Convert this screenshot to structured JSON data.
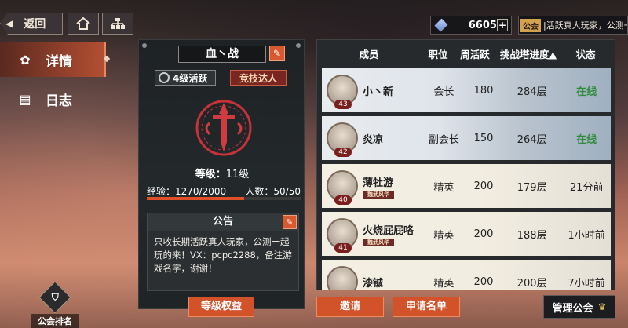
{
  "topbar": {
    "back_label": "返回",
    "currency_value": "6605",
    "ticker_tag": "公会",
    "ticker_text": "|活跃真人玩家，公测一"
  },
  "nav": {
    "detail_label": "详情",
    "log_label": "日志",
    "rank_label": "公会排名"
  },
  "guild": {
    "name": "血丶战",
    "activity_tag": "4级活跃",
    "arena_tag": "竞技达人",
    "level_label": "等级：",
    "level_value": "11级",
    "exp_label": "经验：1270/2000",
    "members_label": "人数：50/50",
    "exp_fraction": 0.635,
    "notice_title": "公告",
    "notice_text": "只收长期活跃真人玩家，公测一起玩的来！VX：pcpc2288，备注游戏名字，谢谢！",
    "benefit_button": "等级权益"
  },
  "members": {
    "headers": {
      "member": "成员",
      "role": "职位",
      "weekly": "周活跃",
      "tower": "挑战塔进度▲",
      "status": "状态"
    },
    "rows": [
      {
        "level": "43",
        "name": "小丶新",
        "sub": "",
        "role": "会长",
        "weekly": "180",
        "tower": "284层",
        "status": "在线",
        "snow": true
      },
      {
        "level": "42",
        "name": "炎凉",
        "sub": "",
        "role": "副会长",
        "weekly": "150",
        "tower": "264层",
        "status": "在线",
        "snow": true
      },
      {
        "level": "40",
        "name": "薄牡游",
        "sub": "魏武风华",
        "role": "精英",
        "weekly": "200",
        "tower": "179层",
        "status": "21分前",
        "snow": false
      },
      {
        "level": "41",
        "name": "火烧屁屁咯",
        "sub": "魏武风华",
        "role": "精英",
        "weekly": "200",
        "tower": "188层",
        "status": "1小时前",
        "snow": false
      },
      {
        "level": "",
        "name": "漆铖",
        "sub": "",
        "role": "精英",
        "weekly": "200",
        "tower": "200层",
        "status": "7小时前",
        "snow": false
      }
    ]
  },
  "actions": {
    "invite": "邀请",
    "apply_list": "申请名单",
    "manage": "管理公会"
  },
  "colors": {
    "accent": "#d2522a",
    "online": "#2f8a3a"
  }
}
